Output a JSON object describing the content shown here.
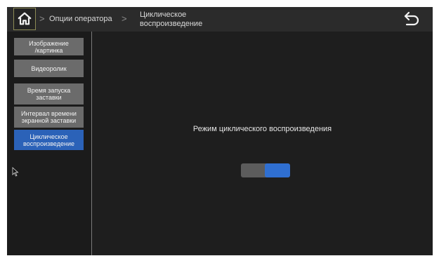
{
  "header": {
    "home_icon": "home-icon",
    "breadcrumbs": [
      "Опции оператора",
      "Циклическое\nвоспроизведение"
    ],
    "back_icon": "back-arrow-icon"
  },
  "sidebar": {
    "items": [
      {
        "label": "Изображение\n/картинка",
        "active": false
      },
      {
        "label": "Видеоролик",
        "active": false
      },
      {
        "label": "Время запуска\nзаставки",
        "active": false
      },
      {
        "label": "Интервал времени\nэкранной заставки",
        "active": false
      },
      {
        "label": "Циклическое\nвоспроизведение",
        "active": true
      }
    ]
  },
  "main": {
    "mode_label": "Режим циклического воспроизведения",
    "loop_toggle": {
      "on": true
    }
  },
  "colors": {
    "active_item": "#2b62b8",
    "toggle_on": "#2f6fd1",
    "inactive_item": "#6b6b6b"
  }
}
